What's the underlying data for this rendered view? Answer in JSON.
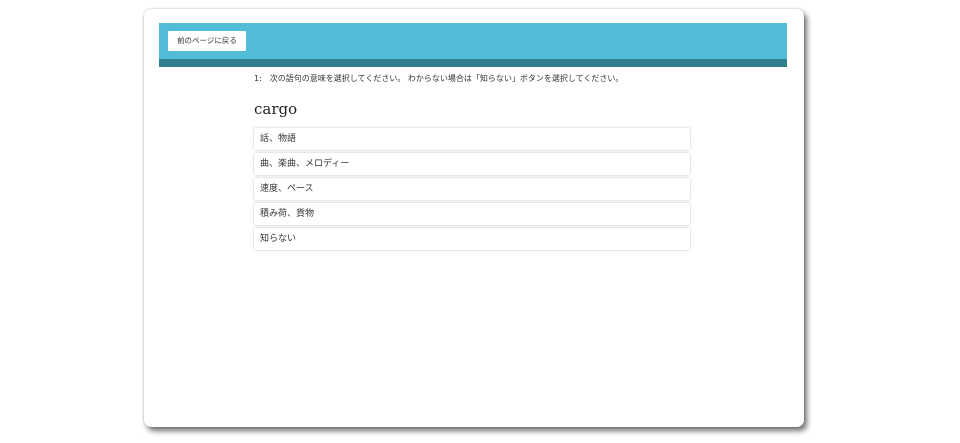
{
  "header": {
    "back_button_label": "前のページに戻る"
  },
  "question": {
    "number": "1:",
    "instruction": "次の語句の意味を選択してください。 わからない場合は「知らない」ボタンを選択してください。",
    "word": "cargo"
  },
  "options": [
    {
      "label": "話、物語"
    },
    {
      "label": "曲、楽曲、メロディー"
    },
    {
      "label": "速度、ペース"
    },
    {
      "label": "積み荷、貨物"
    },
    {
      "label": "知らない"
    }
  ],
  "colors": {
    "header_bg": "#52bcd6",
    "header_strip": "#307f8f"
  }
}
